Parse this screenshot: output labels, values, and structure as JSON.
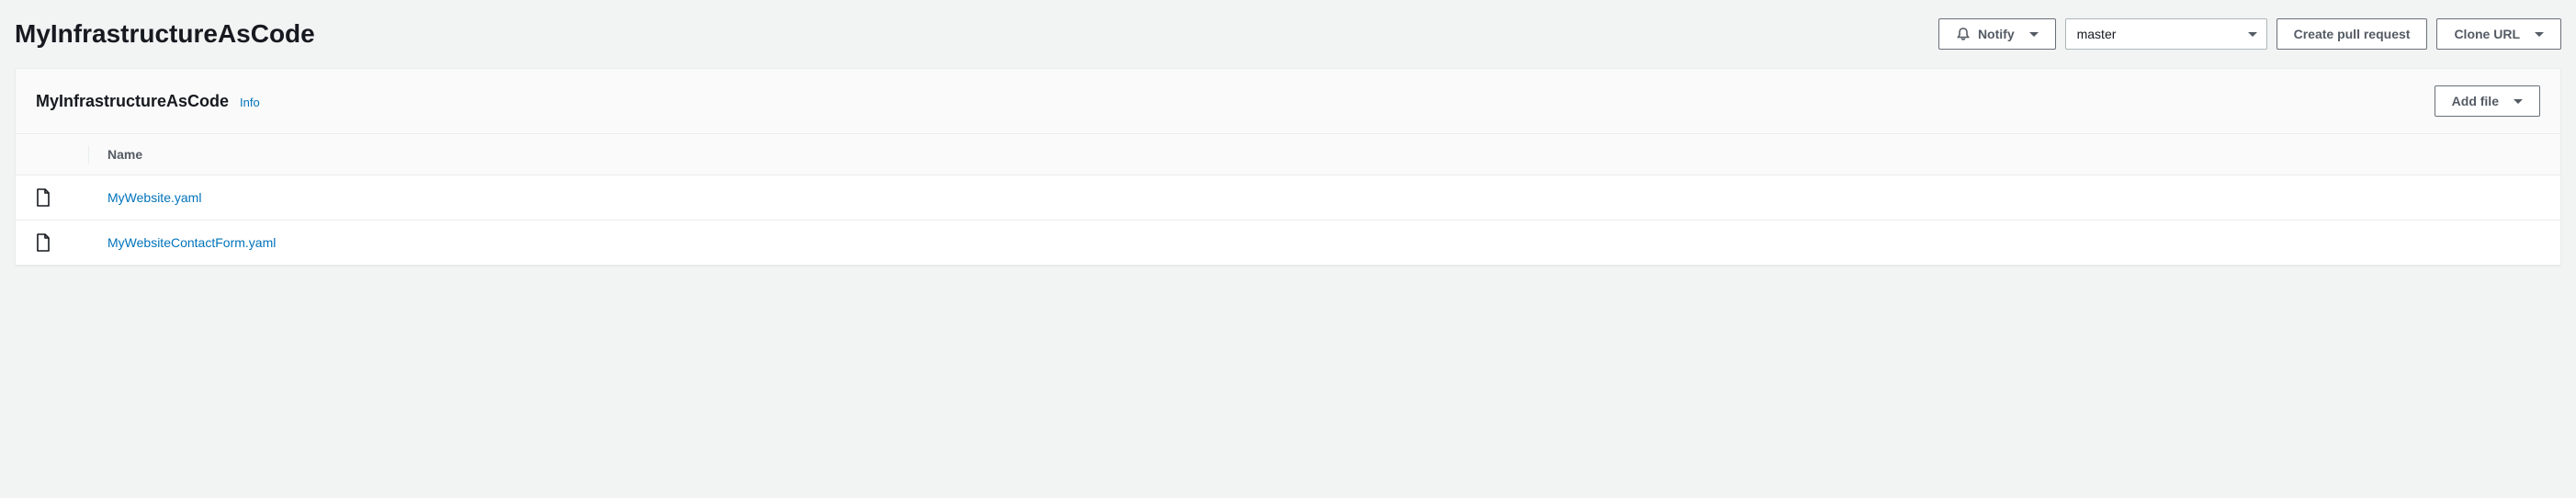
{
  "page": {
    "title": "MyInfrastructureAsCode"
  },
  "header": {
    "notify_label": "Notify",
    "branch_selected": "master",
    "create_pr_label": "Create pull request",
    "clone_url_label": "Clone URL"
  },
  "panel": {
    "title": "MyInfrastructureAsCode",
    "info_label": "Info",
    "add_file_label": "Add file"
  },
  "table": {
    "columns": {
      "name": "Name"
    },
    "rows": [
      {
        "name": "MyWebsite.yaml"
      },
      {
        "name": "MyWebsiteContactForm.yaml"
      }
    ]
  }
}
